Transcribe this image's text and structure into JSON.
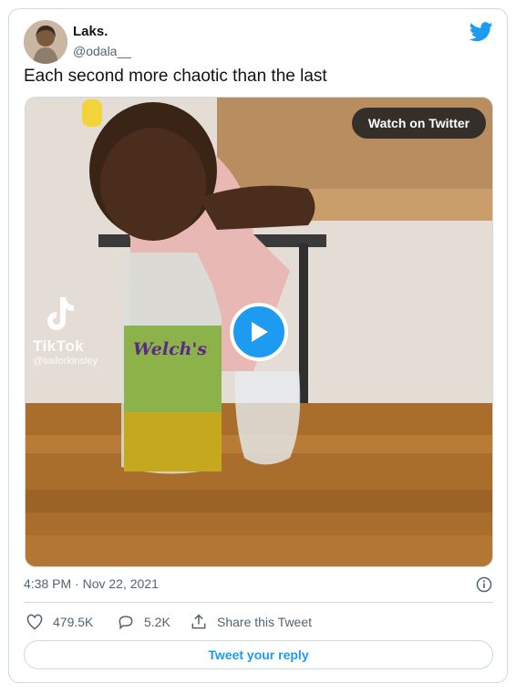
{
  "author": {
    "name": "Laks.",
    "handle": "@odala__"
  },
  "tweet": {
    "text": "Each second more chaotic than the last",
    "timestamp": "4:38 PM · Nov 22, 2021"
  },
  "media": {
    "watch_label": "Watch on Twitter",
    "tiktok_label": "TikTok",
    "tiktok_user": "@sailorkinsley",
    "bottle_brand": "Welch's"
  },
  "actions": {
    "likes": "479.5K",
    "replies": "5.2K",
    "share_label": "Share this Tweet"
  },
  "reply": {
    "label": "Tweet your reply"
  },
  "colors": {
    "accent": "#1d9bf0",
    "text_secondary": "#536471",
    "border": "#cfd9de"
  },
  "icons": [
    "twitter-bird-icon",
    "info-icon",
    "heart-icon",
    "reply-icon",
    "share-icon",
    "play-icon",
    "tiktok-icon"
  ]
}
